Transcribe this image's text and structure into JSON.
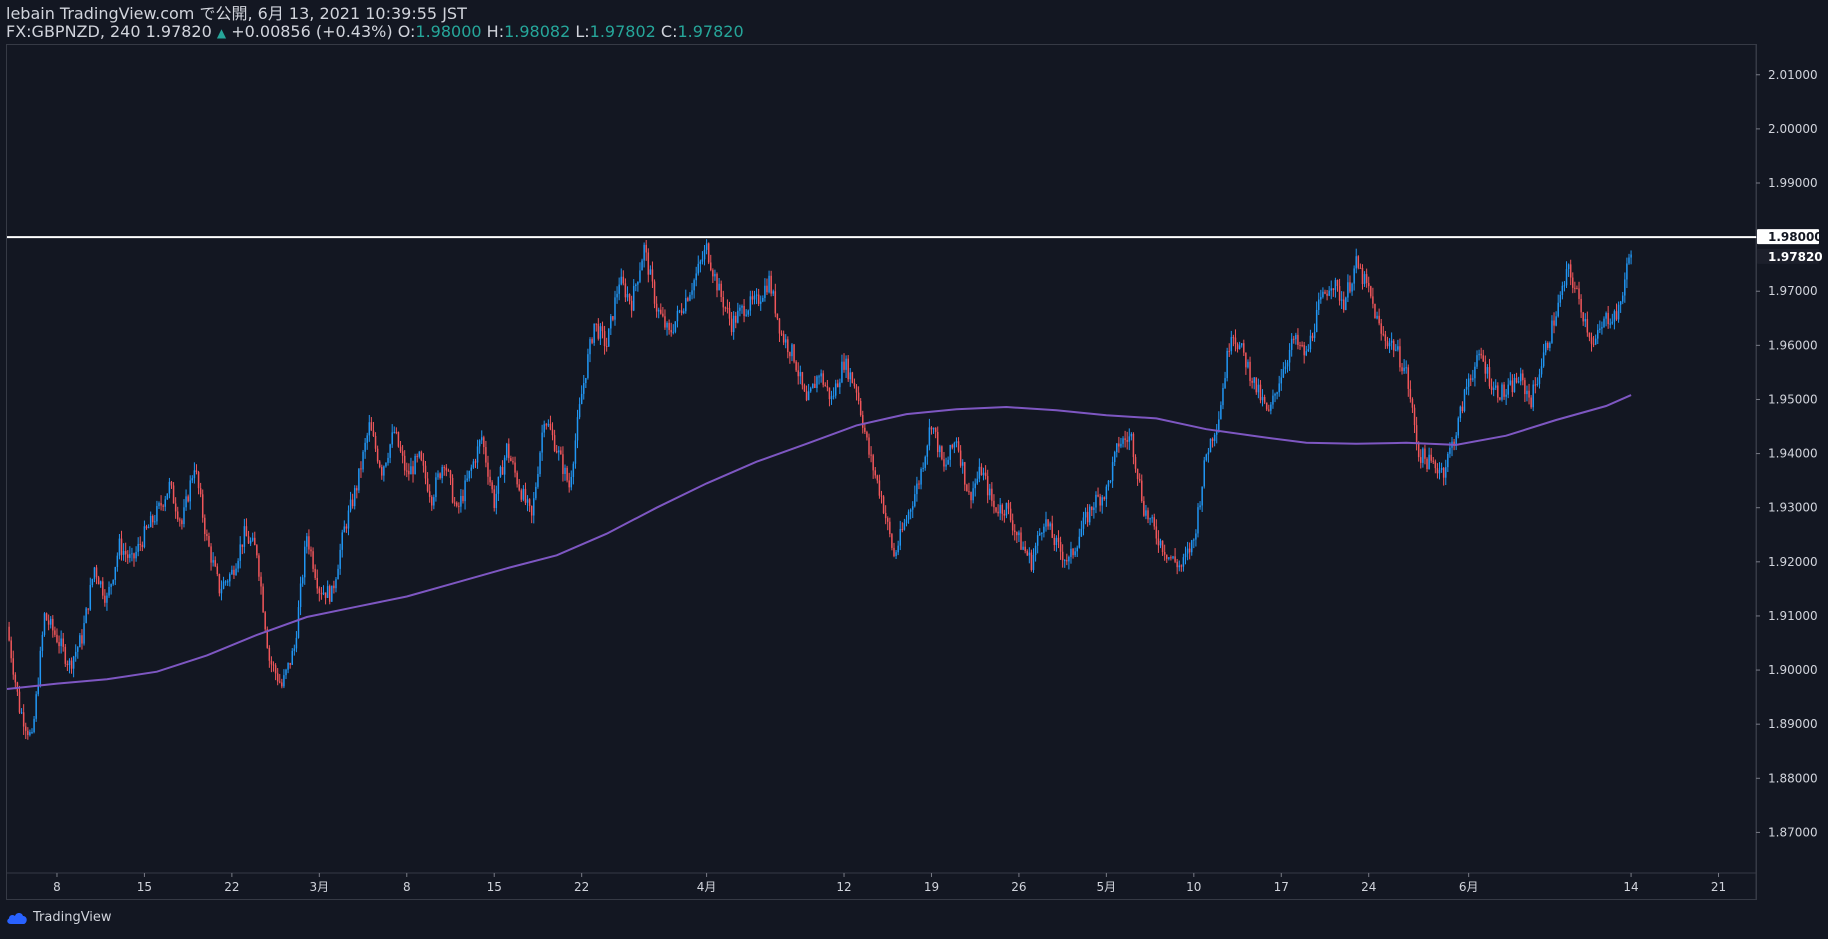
{
  "header": {
    "line1": "lebain TradingView.com で公開, 6月 13, 2021 10:39:55 JST",
    "symbol": "FX:GBPNZD, 240 1.97820",
    "change_arrow": "▲",
    "change": "+0.00856 (+0.43%)",
    "o_label": "O:",
    "o_value": "1.98000",
    "h_label": "H:",
    "h_value": "1.98082",
    "l_label": "L:",
    "l_value": "1.97802",
    "c_label": "C:",
    "c_value": "1.97820"
  },
  "footer": {
    "brand": "TradingView",
    "logo_icon": "tradingview-cloud-icon"
  },
  "colors": {
    "background": "#131722",
    "up": "#2196f3",
    "down": "#f0565a",
    "ma": "#7e57c2",
    "hline": "#ffffff",
    "text": "#d1d4dc",
    "teal": "#26a69a"
  },
  "chart_data": {
    "type": "candlestick",
    "symbol": "FX:GBPNZD",
    "timeframe": "240",
    "ylim": [
      1.8625,
      2.0155
    ],
    "y_ticks": [
      "2.01000",
      "2.00000",
      "1.99000",
      "1.98000",
      "1.97000",
      "1.96000",
      "1.95000",
      "1.94000",
      "1.93000",
      "1.92000",
      "1.91000",
      "1.90000",
      "1.89000",
      "1.88000",
      "1.87000"
    ],
    "x_ticks": [
      {
        "date": "2021-02-08",
        "label": "8"
      },
      {
        "date": "2021-02-15",
        "label": "15"
      },
      {
        "date": "2021-02-22",
        "label": "22"
      },
      {
        "date": "2021-03-01",
        "label": "3月"
      },
      {
        "date": "2021-03-08",
        "label": "8"
      },
      {
        "date": "2021-03-15",
        "label": "15"
      },
      {
        "date": "2021-03-22",
        "label": "22"
      },
      {
        "date": "2021-04-01",
        "label": "4月"
      },
      {
        "date": "2021-04-12",
        "label": "12"
      },
      {
        "date": "2021-04-19",
        "label": "19"
      },
      {
        "date": "2021-04-26",
        "label": "26"
      },
      {
        "date": "2021-05-03",
        "label": "5月"
      },
      {
        "date": "2021-05-10",
        "label": "10"
      },
      {
        "date": "2021-05-17",
        "label": "17"
      },
      {
        "date": "2021-05-24",
        "label": "24"
      },
      {
        "date": "2021-06-01",
        "label": "6月"
      },
      {
        "date": "2021-06-14",
        "label": "14"
      },
      {
        "date": "2021-06-21",
        "label": "21"
      }
    ],
    "x_range": [
      "2021-02-04",
      "2021-06-24"
    ],
    "close_path": [
      [
        "2021-02-04",
        1.908
      ],
      [
        "2021-02-05",
        1.893
      ],
      [
        "2021-02-06",
        1.887
      ],
      [
        "2021-02-07",
        1.91
      ],
      [
        "2021-02-08",
        1.906
      ],
      [
        "2021-02-09",
        1.901
      ],
      [
        "2021-02-10",
        1.906
      ],
      [
        "2021-02-11",
        1.919
      ],
      [
        "2021-02-12",
        1.913
      ],
      [
        "2021-02-13",
        1.923
      ],
      [
        "2021-02-14",
        1.92
      ],
      [
        "2021-02-15",
        1.925
      ],
      [
        "2021-02-16",
        1.929
      ],
      [
        "2021-02-17",
        1.934
      ],
      [
        "2021-02-18",
        1.927
      ],
      [
        "2021-02-19",
        1.938
      ],
      [
        "2021-02-20",
        1.924
      ],
      [
        "2021-02-21",
        1.915
      ],
      [
        "2021-02-22",
        1.918
      ],
      [
        "2021-02-23",
        1.925
      ],
      [
        "2021-02-24",
        1.922
      ],
      [
        "2021-02-25",
        1.902
      ],
      [
        "2021-02-26",
        1.897
      ],
      [
        "2021-02-27",
        1.904
      ],
      [
        "2021-02-28",
        1.925
      ],
      [
        "2021-03-01",
        1.915
      ],
      [
        "2021-03-02",
        1.914
      ],
      [
        "2021-03-03",
        1.926
      ],
      [
        "2021-03-04",
        1.934
      ],
      [
        "2021-03-05",
        1.945
      ],
      [
        "2021-03-06",
        1.937
      ],
      [
        "2021-03-07",
        1.944
      ],
      [
        "2021-03-08",
        1.936
      ],
      [
        "2021-03-09",
        1.939
      ],
      [
        "2021-03-10",
        1.932
      ],
      [
        "2021-03-11",
        1.939
      ],
      [
        "2021-03-12",
        1.929
      ],
      [
        "2021-03-13",
        1.936
      ],
      [
        "2021-03-14",
        1.943
      ],
      [
        "2021-03-15",
        1.931
      ],
      [
        "2021-03-16",
        1.941
      ],
      [
        "2021-03-17",
        1.934
      ],
      [
        "2021-03-18",
        1.928
      ],
      [
        "2021-03-19",
        1.947
      ],
      [
        "2021-03-20",
        1.941
      ],
      [
        "2021-03-21",
        1.934
      ],
      [
        "2021-03-22",
        1.951
      ],
      [
        "2021-03-23",
        1.964
      ],
      [
        "2021-03-24",
        1.96
      ],
      [
        "2021-03-25",
        1.972
      ],
      [
        "2021-03-26",
        1.968
      ],
      [
        "2021-03-27",
        1.978
      ],
      [
        "2021-03-28",
        1.967
      ],
      [
        "2021-03-29",
        1.962
      ],
      [
        "2021-03-30",
        1.967
      ],
      [
        "2021-03-31",
        1.972
      ],
      [
        "2021-04-01",
        1.978
      ],
      [
        "2021-04-02",
        1.97
      ],
      [
        "2021-04-03",
        1.964
      ],
      [
        "2021-04-04",
        1.967
      ],
      [
        "2021-04-05",
        1.968
      ],
      [
        "2021-04-06",
        1.972
      ],
      [
        "2021-04-07",
        1.962
      ],
      [
        "2021-04-08",
        1.958
      ],
      [
        "2021-04-09",
        1.949
      ],
      [
        "2021-04-10",
        1.955
      ],
      [
        "2021-04-11",
        1.95
      ],
      [
        "2021-04-12",
        1.957
      ],
      [
        "2021-04-13",
        1.952
      ],
      [
        "2021-04-14",
        1.94
      ],
      [
        "2021-04-15",
        1.932
      ],
      [
        "2021-04-16",
        1.921
      ],
      [
        "2021-04-17",
        1.928
      ],
      [
        "2021-04-18",
        1.935
      ],
      [
        "2021-04-19",
        1.946
      ],
      [
        "2021-04-20",
        1.937
      ],
      [
        "2021-04-21",
        1.943
      ],
      [
        "2021-04-22",
        1.932
      ],
      [
        "2021-04-23",
        1.937
      ],
      [
        "2021-04-24",
        1.93
      ],
      [
        "2021-04-25",
        1.93
      ],
      [
        "2021-04-26",
        1.924
      ],
      [
        "2021-04-27",
        1.92
      ],
      [
        "2021-04-28",
        1.928
      ],
      [
        "2021-04-29",
        1.923
      ],
      [
        "2021-04-30",
        1.92
      ],
      [
        "2021-05-01",
        1.926
      ],
      [
        "2021-05-02",
        1.931
      ],
      [
        "2021-05-03",
        1.933
      ],
      [
        "2021-05-04",
        1.942
      ],
      [
        "2021-05-05",
        1.943
      ],
      [
        "2021-05-06",
        1.93
      ],
      [
        "2021-05-07",
        1.925
      ],
      [
        "2021-05-08",
        1.921
      ],
      [
        "2021-05-09",
        1.919
      ],
      [
        "2021-05-10",
        1.924
      ],
      [
        "2021-05-11",
        1.94
      ],
      [
        "2021-05-12",
        1.947
      ],
      [
        "2021-05-13",
        1.963
      ],
      [
        "2021-05-14",
        1.958
      ],
      [
        "2021-05-15",
        1.952
      ],
      [
        "2021-05-16",
        1.947
      ],
      [
        "2021-05-17",
        1.955
      ],
      [
        "2021-05-18",
        1.961
      ],
      [
        "2021-05-19",
        1.958
      ],
      [
        "2021-05-20",
        1.967
      ],
      [
        "2021-05-21",
        1.972
      ],
      [
        "2021-05-22",
        1.968
      ],
      [
        "2021-05-23",
        1.975
      ],
      [
        "2021-05-24",
        1.97
      ],
      [
        "2021-05-25",
        1.962
      ],
      [
        "2021-05-26",
        1.96
      ],
      [
        "2021-05-27",
        1.955
      ],
      [
        "2021-05-28",
        1.94
      ],
      [
        "2021-05-29",
        1.938
      ],
      [
        "2021-05-30",
        1.937
      ],
      [
        "2021-05-31",
        1.944
      ],
      [
        "2021-06-01",
        1.954
      ],
      [
        "2021-06-02",
        1.958
      ],
      [
        "2021-06-03",
        1.952
      ],
      [
        "2021-06-04",
        1.951
      ],
      [
        "2021-06-05",
        1.954
      ],
      [
        "2021-06-06",
        1.95
      ],
      [
        "2021-06-07",
        1.958
      ],
      [
        "2021-06-08",
        1.966
      ],
      [
        "2021-06-09",
        1.974
      ],
      [
        "2021-06-10",
        1.967
      ],
      [
        "2021-06-11",
        1.96
      ],
      [
        "2021-06-12",
        1.965
      ],
      [
        "2021-06-13",
        1.966
      ],
      [
        "2021-06-14",
        1.9782
      ]
    ],
    "moving_average": [
      [
        "2021-02-04",
        1.8965
      ],
      [
        "2021-02-08",
        1.8975
      ],
      [
        "2021-02-12",
        1.8983
      ],
      [
        "2021-02-16",
        1.8997
      ],
      [
        "2021-02-20",
        1.9027
      ],
      [
        "2021-02-24",
        1.9065
      ],
      [
        "2021-02-28",
        1.9098
      ],
      [
        "2021-03-04",
        1.9117
      ],
      [
        "2021-03-08",
        1.9136
      ],
      [
        "2021-03-12",
        1.9162
      ],
      [
        "2021-03-16",
        1.9188
      ],
      [
        "2021-03-20",
        1.9212
      ],
      [
        "2021-03-24",
        1.9252
      ],
      [
        "2021-03-28",
        1.93
      ],
      [
        "2021-04-01",
        1.9345
      ],
      [
        "2021-04-05",
        1.9385
      ],
      [
        "2021-04-09",
        1.9418
      ],
      [
        "2021-04-13",
        1.9452
      ],
      [
        "2021-04-17",
        1.9473
      ],
      [
        "2021-04-21",
        1.9482
      ],
      [
        "2021-04-25",
        1.9486
      ],
      [
        "2021-04-29",
        1.948
      ],
      [
        "2021-05-03",
        1.9471
      ],
      [
        "2021-05-07",
        1.9465
      ],
      [
        "2021-05-11",
        1.9445
      ],
      [
        "2021-05-15",
        1.9432
      ],
      [
        "2021-05-19",
        1.942
      ],
      [
        "2021-05-23",
        1.9418
      ],
      [
        "2021-05-27",
        1.942
      ],
      [
        "2021-05-31",
        1.9416
      ],
      [
        "2021-06-04",
        1.9433
      ],
      [
        "2021-06-08",
        1.9462
      ],
      [
        "2021-06-12",
        1.9488
      ],
      [
        "2021-06-14",
        1.9508
      ]
    ],
    "horizontal_line": 1.98,
    "price_labels": [
      {
        "value": 1.98,
        "label": "1.98000"
      },
      {
        "value": 1.9782,
        "label": "1.97820"
      }
    ]
  }
}
